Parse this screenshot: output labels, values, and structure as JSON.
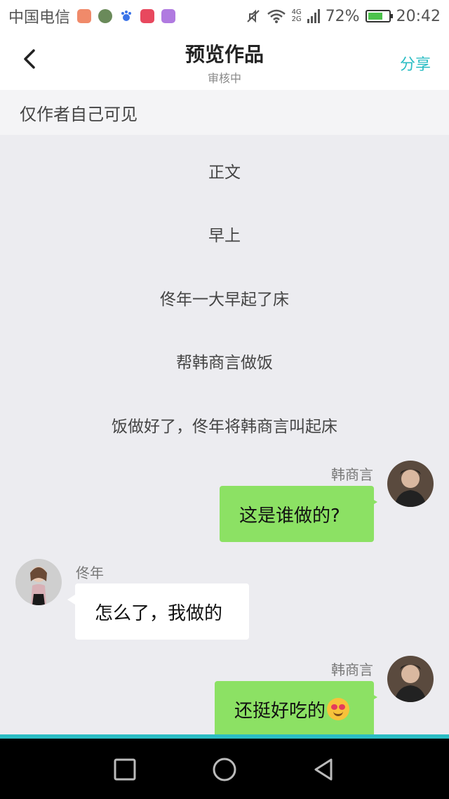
{
  "status_bar": {
    "carrier": "中国电信",
    "network_top": "4G",
    "network_bottom": "2G",
    "battery": "72%",
    "battery_level": 0.72,
    "time": "20:42",
    "app_icons": [
      "mail-app-icon",
      "photo-app-icon",
      "baidu-app-icon",
      "huawei-app-icon",
      "gallery-app-icon"
    ]
  },
  "header": {
    "title": "预览作品",
    "subtitle": "审核中",
    "share_label": "分享"
  },
  "notice": "仅作者自己可见",
  "narration": [
    "正文",
    "早上",
    "佟年一大早起了床",
    "帮韩商言做饭",
    "饭做好了，佟年将韩商言叫起床"
  ],
  "messages": [
    {
      "side": "right",
      "sender": "韩商言",
      "text": "这是谁做的?"
    },
    {
      "side": "left",
      "sender": "佟年",
      "text": "怎么了，我做的"
    },
    {
      "side": "right",
      "sender": "韩商言",
      "text": "还挺好吃的",
      "emoji": "heart-eyes-emoji"
    }
  ],
  "colors": {
    "accent": "#2bbdc4",
    "bubble_green": "#8ce164",
    "background": "#ececf0"
  },
  "nav_bar": [
    "recents-button",
    "home-button",
    "back-button"
  ]
}
